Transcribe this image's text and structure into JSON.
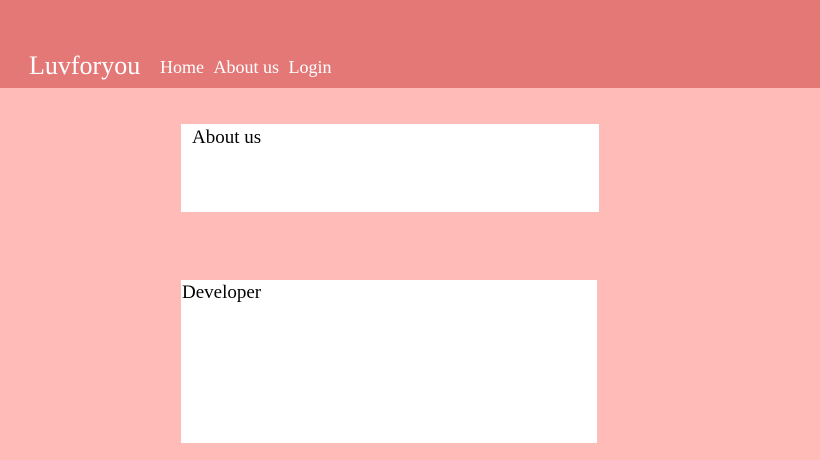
{
  "navbar": {
    "brand": "Luvforyou",
    "links": [
      {
        "label": "Home"
      },
      {
        "label": "About us"
      },
      {
        "label": "Login"
      }
    ]
  },
  "main": {
    "about_title": "About us",
    "developer_title": "Developer"
  },
  "colors": {
    "navbar_bg": "#e47877",
    "page_bg": "#ffbbb8",
    "panel_bg": "#ffffff"
  }
}
